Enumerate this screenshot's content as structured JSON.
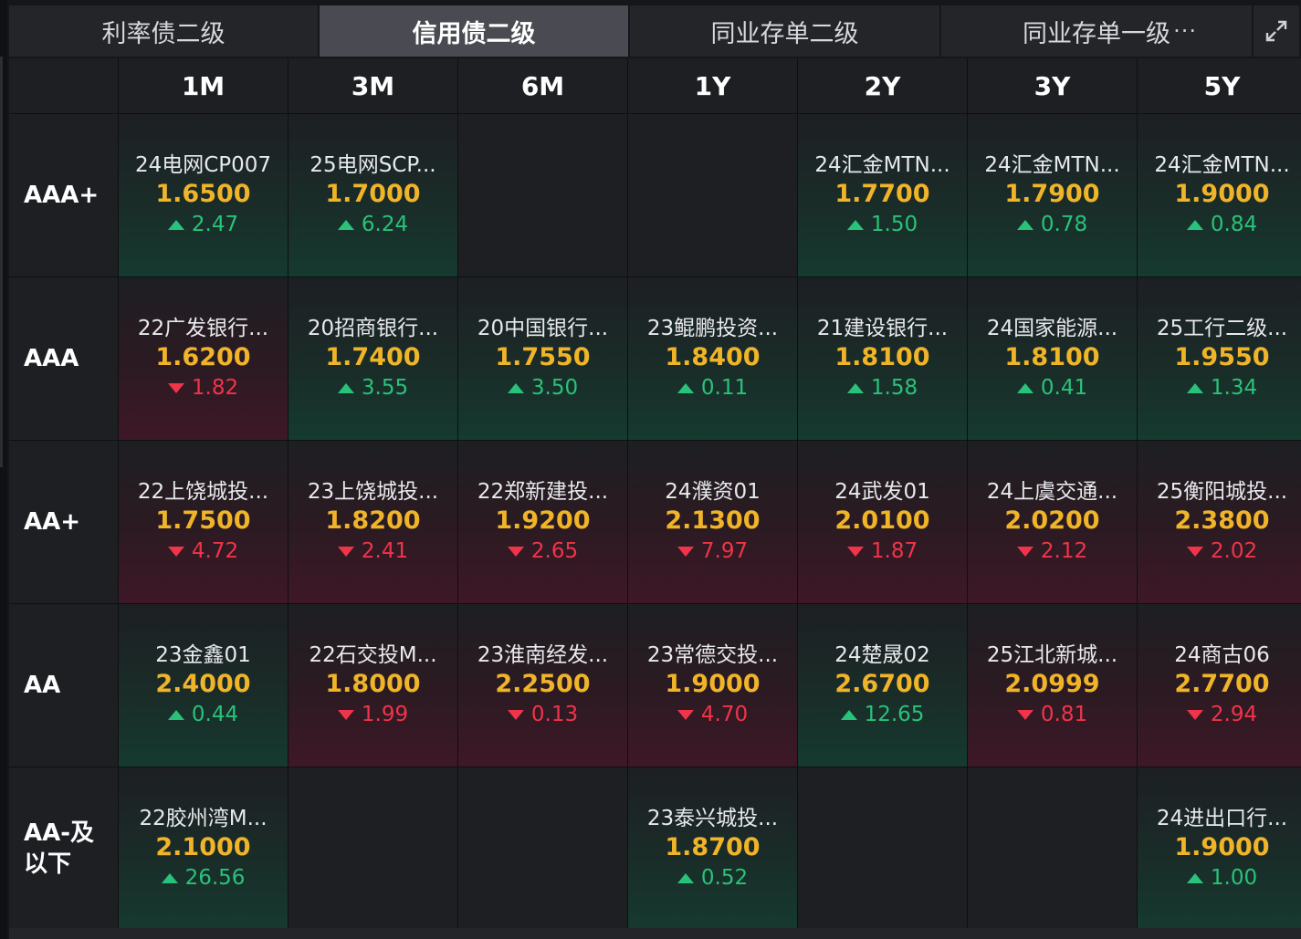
{
  "tabs": [
    {
      "label": "利率债二级",
      "active": false
    },
    {
      "label": "信用债二级",
      "active": true
    },
    {
      "label": "同业存单二级",
      "active": false
    },
    {
      "label": "同业存单一级",
      "active": false
    }
  ],
  "more_label": "···",
  "columns": [
    "1M",
    "3M",
    "6M",
    "1Y",
    "2Y",
    "3Y",
    "5Y"
  ],
  "rows": [
    {
      "rating": "AAA+",
      "cells": [
        {
          "name": "24电网CP007",
          "yield": "1.6500",
          "change": "2.47",
          "dir": "up"
        },
        {
          "name": "25电网SCP...",
          "yield": "1.7000",
          "change": "6.24",
          "dir": "up"
        },
        null,
        null,
        {
          "name": "24汇金MTN...",
          "yield": "1.7700",
          "change": "1.50",
          "dir": "up"
        },
        {
          "name": "24汇金MTN...",
          "yield": "1.7900",
          "change": "0.78",
          "dir": "up"
        },
        {
          "name": "24汇金MTN...",
          "yield": "1.9000",
          "change": "0.84",
          "dir": "up"
        }
      ]
    },
    {
      "rating": "AAA",
      "cells": [
        {
          "name": "22广发银行...",
          "yield": "1.6200",
          "change": "1.82",
          "dir": "down"
        },
        {
          "name": "20招商银行...",
          "yield": "1.7400",
          "change": "3.55",
          "dir": "up"
        },
        {
          "name": "20中国银行...",
          "yield": "1.7550",
          "change": "3.50",
          "dir": "up"
        },
        {
          "name": "23鲲鹏投资...",
          "yield": "1.8400",
          "change": "0.11",
          "dir": "up"
        },
        {
          "name": "21建设银行...",
          "yield": "1.8100",
          "change": "1.58",
          "dir": "up"
        },
        {
          "name": "24国家能源...",
          "yield": "1.8100",
          "change": "0.41",
          "dir": "up"
        },
        {
          "name": "25工行二级...",
          "yield": "1.9550",
          "change": "1.34",
          "dir": "up"
        }
      ]
    },
    {
      "rating": "AA+",
      "cells": [
        {
          "name": "22上饶城投...",
          "yield": "1.7500",
          "change": "4.72",
          "dir": "down"
        },
        {
          "name": "23上饶城投...",
          "yield": "1.8200",
          "change": "2.41",
          "dir": "down"
        },
        {
          "name": "22郑新建投...",
          "yield": "1.9200",
          "change": "2.65",
          "dir": "down"
        },
        {
          "name": "24濮资01",
          "yield": "2.1300",
          "change": "7.97",
          "dir": "down"
        },
        {
          "name": "24武发01",
          "yield": "2.0100",
          "change": "1.87",
          "dir": "down"
        },
        {
          "name": "24上虞交通...",
          "yield": "2.0200",
          "change": "2.12",
          "dir": "down"
        },
        {
          "name": "25衡阳城投...",
          "yield": "2.3800",
          "change": "2.02",
          "dir": "down"
        }
      ]
    },
    {
      "rating": "AA",
      "cells": [
        {
          "name": "23金鑫01",
          "yield": "2.4000",
          "change": "0.44",
          "dir": "up"
        },
        {
          "name": "22石交投M...",
          "yield": "1.8000",
          "change": "1.99",
          "dir": "down"
        },
        {
          "name": "23淮南经发...",
          "yield": "2.2500",
          "change": "0.13",
          "dir": "down"
        },
        {
          "name": "23常德交投...",
          "yield": "1.9000",
          "change": "4.70",
          "dir": "down"
        },
        {
          "name": "24楚晟02",
          "yield": "2.6700",
          "change": "12.65",
          "dir": "up"
        },
        {
          "name": "25江北新城...",
          "yield": "2.0999",
          "change": "0.81",
          "dir": "down"
        },
        {
          "name": "24商古06",
          "yield": "2.7700",
          "change": "2.94",
          "dir": "down"
        }
      ]
    },
    {
      "rating_line1": "AA-及",
      "rating_line2": "以下",
      "cells": [
        {
          "name": "22胶州湾M...",
          "yield": "2.1000",
          "change": "26.56",
          "dir": "up"
        },
        null,
        null,
        {
          "name": "23泰兴城投...",
          "yield": "1.8700",
          "change": "0.52",
          "dir": "up"
        },
        null,
        null,
        {
          "name": "24进出口行...",
          "yield": "1.9000",
          "change": "1.00",
          "dir": "up"
        }
      ]
    }
  ]
}
